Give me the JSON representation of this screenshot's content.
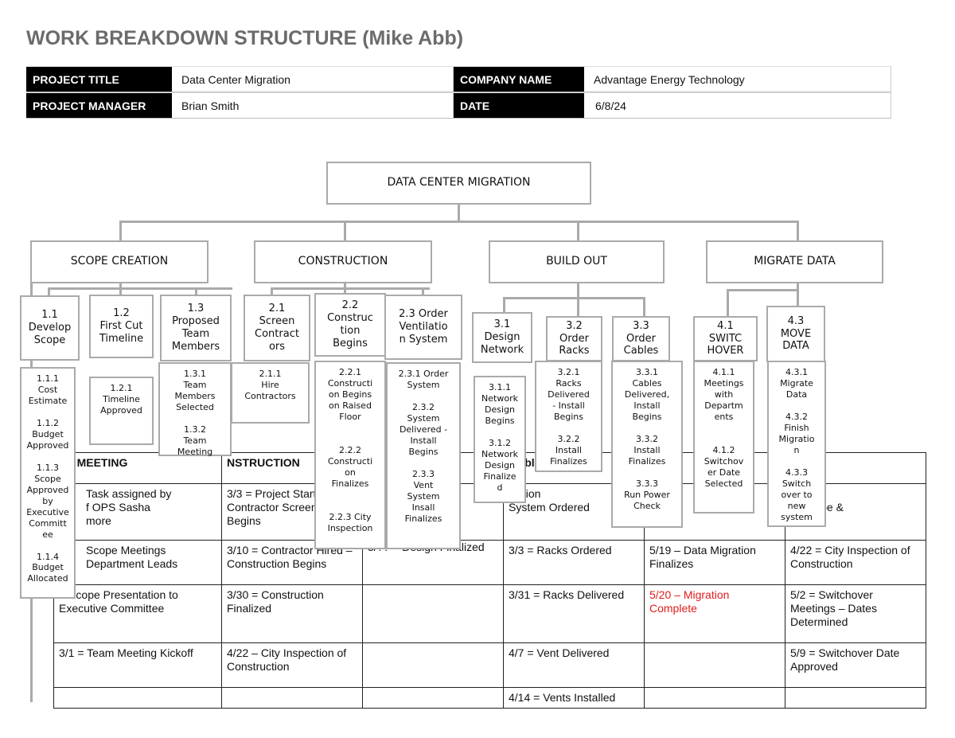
{
  "title": "WORK BREAKDOWN STRUCTURE  (Mike Abb)",
  "info": {
    "project_title_label": "PROJECT TITLE",
    "project_title": "Data Center Migration",
    "company_name_label": "COMPANY NAME",
    "company_name": "Advantage Energy Technology",
    "project_manager_label": "PROJECT MANAGER",
    "project_manager": "Brian Smith",
    "date_label": "DATE",
    "date": "6/8/24"
  },
  "wbs": {
    "root": "DATA CENTER MIGRATION",
    "l1": [
      "SCOPE CREATION",
      "CONSTRUCTION",
      "BUILD OUT",
      "MIGRATE DATA"
    ],
    "l2": [
      "1.1\nDevelop\nScope",
      "1.2\nFirst Cut\nTimeline",
      "1.3\nProposed\nTeam\nMembers",
      "2.1\nScreen\nContract\nors",
      "2.2\nConstruc\ntion\nBegins",
      "2.3 Order\nVentilatio\nn System",
      "3.1\nDesign\nNetwork",
      "3.2\nOrder\nRacks",
      "3.3\nOrder\nCables",
      "4.1\nSWITC\nHOVER",
      "4.3\nMOVE\nDATA"
    ],
    "l3": [
      "1.1.1\nCost\nEstimate\n\n1.1.2\nBudget\nApproved\n\n1.1.3\nScope\nApproved\nby\nExecutive\nCommitt\nee\n\n1.1.4\nBudget\nAllocated",
      "1.2.1\nTimeline\nApproved",
      "1.3.1\nTeam\nMembers\nSelected\n\n1.3.2\nTeam\nMeeting",
      "2.1.1\nHire\nContractors",
      "2.2.1\nConstructi\non Begins\non Raised\nFloor\n\n\n2.2.2\nConstructi\non\nFinalizes\n\n\n2.2.3 City\nInspection",
      "2.3.1 Order\nSystem\n\n2.3.2\nSystem\nDelivered -\nInstall\nBegins\n\n2.3.3\nVent\nSystem\nInsall\nFinalizes",
      "3.1.1\nNetwork\nDesign\nBegins\n\n3.1.2\nNetwork\nDesign\nFinalize\nd",
      "3.2.1\nRacks\nDelivered\n- Install\nBegins\n\n3.2.2\nInstall\nFinalizes",
      "3.3.1\nCables\nDelivered,\nInstall\nBegins\n\n3.3.2\nInstall\nFinalizes\n\n3.3.3\nRun Power\nCheck",
      "4.1.1\nMeetings\nwith\nDepartm\nents\n\n\n4.1.2\nSwitchov\ner Date\nSelected",
      "4.3.1\nMigrate\nData\n\n4.3.2\nFinish\nMigratio\nn\n\n4.3.3\nSwitch\nover to\nnew\nsystem"
    ]
  },
  "schedule": {
    "rows": [
      [
        "PE MEETING",
        "NSTRUCTION",
        "",
        "(cables)",
        "RA",
        "A       S"
      ],
      [
        "Task assigned by\nf OPS Sasha\nmore",
        "3/3 = Project Start Date, Contractor Screening Begins",
        "",
        "tilation\nSystem Ordered",
        "",
        "2          utive\nC          Scope &\nE          eam"
      ],
      [
        "Scope Meetings\nDepartment Leads",
        "3/10 = Contractor Hired – Construction Begins",
        "3/?? = Design Finalized",
        "3/3 = Racks Ordered",
        "5/19 – Data Migration Finalizes",
        "4/22 = City Inspection of Construction"
      ],
      [
        "= Scope Presentation to Executive Committee",
        "3/30 = Construction Finalized",
        "",
        "3/31 = Racks Delivered",
        "5/20 – Migration Complete",
        "5/2 = Switchover Meetings – Dates Determined"
      ],
      [
        "3/1 = Team Meeting Kickoff",
        "4/22 – City Inspection of Construction",
        "",
        "4/7 = Vent Delivered",
        "",
        "5/9 = Switchover Date Approved"
      ],
      [
        "",
        "",
        "",
        "4/14 = Vents Installed",
        "",
        ""
      ]
    ],
    "highlight_color": "#e31b1b"
  }
}
